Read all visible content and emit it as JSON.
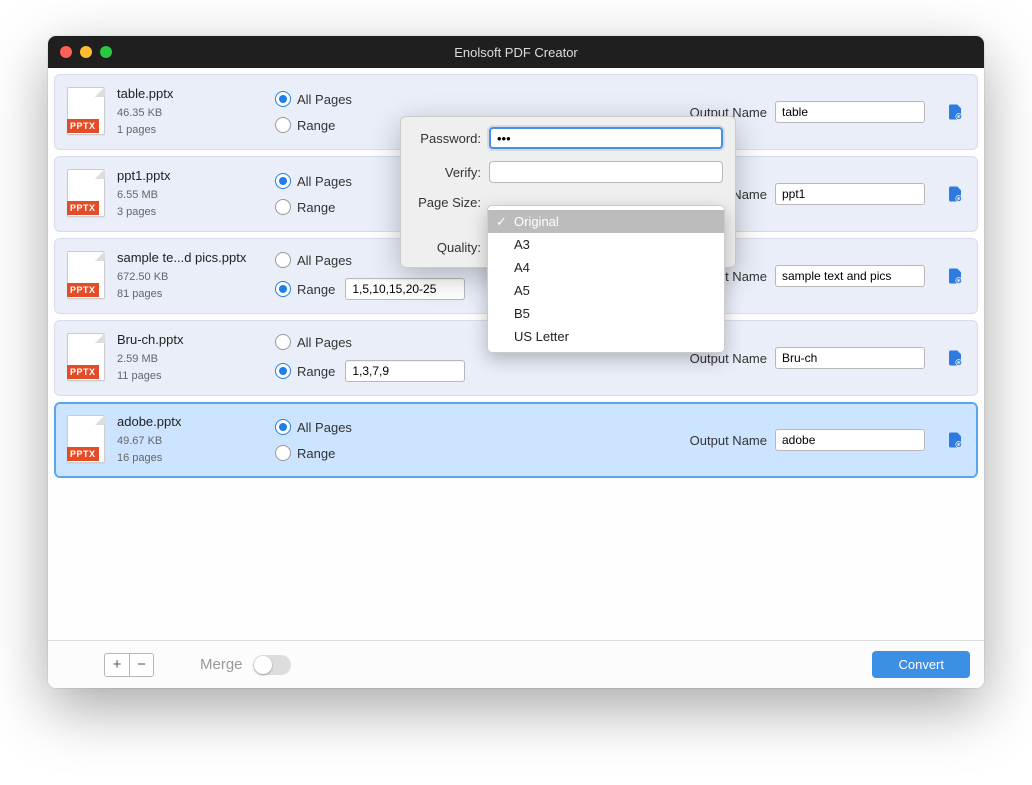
{
  "window": {
    "title": "Enolsoft PDF Creator"
  },
  "labels": {
    "all_pages": "All Pages",
    "range": "Range",
    "output_name": "Output Name",
    "merge": "Merge",
    "convert": "Convert",
    "add": "+",
    "remove": "−"
  },
  "files": [
    {
      "name": "table.pptx",
      "size": "46.35 KB",
      "pages": "1 pages",
      "type": "PPTX",
      "all_pages": true,
      "range_value": "",
      "output": "table",
      "selected": false
    },
    {
      "name": "ppt1.pptx",
      "size": "6.55 MB",
      "pages": "3 pages",
      "type": "PPTX",
      "all_pages": true,
      "range_value": "",
      "output": "ppt1",
      "selected": false
    },
    {
      "name": "sample te...d pics.pptx",
      "size": "672.50 KB",
      "pages": "81 pages",
      "type": "PPTX",
      "all_pages": false,
      "range_value": "1,5,10,15,20-25",
      "output": "sample text and pics",
      "selected": false
    },
    {
      "name": "Bru-ch.pptx",
      "size": "2.59 MB",
      "pages": "11 pages",
      "type": "PPTX",
      "all_pages": false,
      "range_value": "1,3,7,9",
      "output": "Bru-ch",
      "selected": false
    },
    {
      "name": "adobe.pptx",
      "size": "49.67 KB",
      "pages": "16 pages",
      "type": "PPTX",
      "all_pages": true,
      "range_value": "",
      "output": "adobe",
      "selected": true
    }
  ],
  "popover": {
    "password_label": "Password:",
    "password_value": "•••",
    "verify_label": "Verify:",
    "verify_value": "",
    "page_size_label": "Page Size:",
    "quality_label": "Quality:",
    "page_size_options": [
      "Original",
      "A3",
      "A4",
      "A5",
      "B5",
      "US Letter"
    ],
    "page_size_selected": "Original"
  }
}
